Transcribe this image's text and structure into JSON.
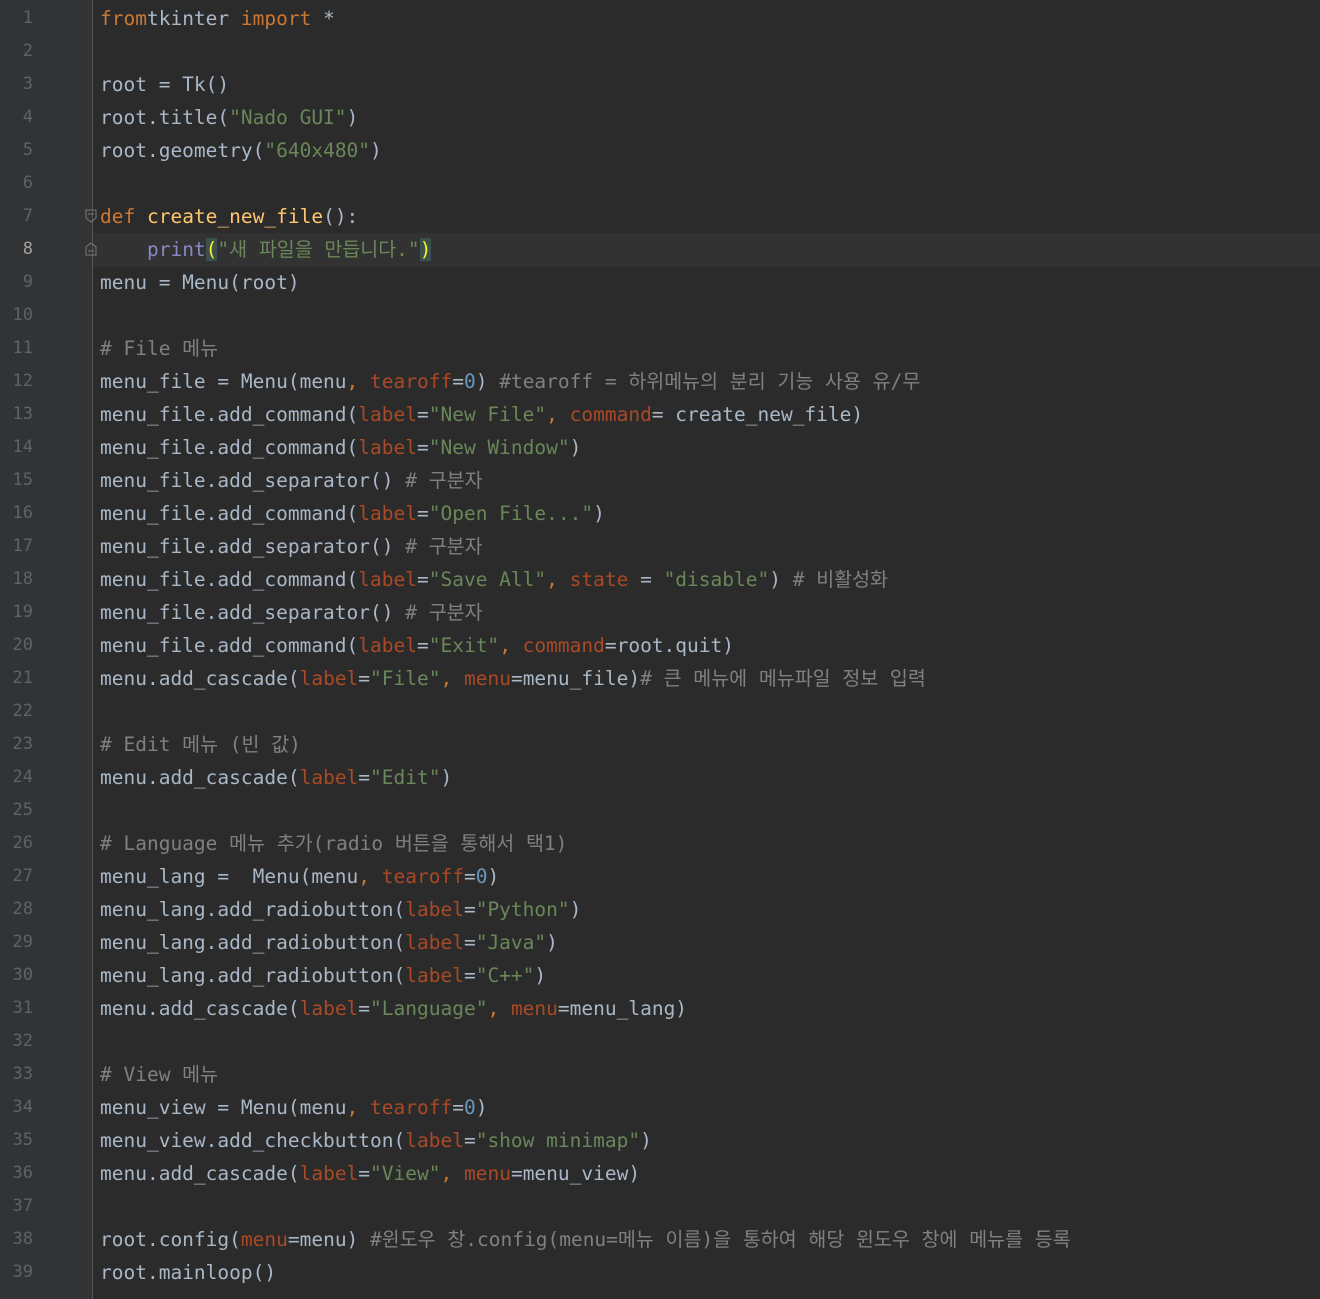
{
  "editor": {
    "current_line": 8,
    "lines": [
      {
        "n": "1",
        "tokens": [
          [
            "k",
            "from"
          ],
          [
            "",
            "tkinter "
          ],
          [
            "k",
            "import"
          ],
          [
            "",
            " *"
          ]
        ]
      },
      {
        "n": "2",
        "tokens": []
      },
      {
        "n": "3",
        "tokens": [
          [
            "",
            "root = Tk()"
          ]
        ]
      },
      {
        "n": "4",
        "tokens": [
          [
            "",
            "root.title("
          ],
          [
            "s",
            "\"Nado GUI\""
          ],
          [
            "",
            ")"
          ]
        ]
      },
      {
        "n": "5",
        "tokens": [
          [
            "",
            "root.geometry("
          ],
          [
            "s",
            "\"640x480\""
          ],
          [
            "",
            ")"
          ]
        ]
      },
      {
        "n": "6",
        "tokens": []
      },
      {
        "n": "7",
        "tokens": [
          [
            "k",
            "def "
          ],
          [
            "f",
            "create_new_file"
          ],
          [
            "",
            "():"
          ]
        ]
      },
      {
        "n": "8",
        "tokens": [
          [
            "",
            "    "
          ],
          [
            "b",
            "print"
          ],
          [
            "brace",
            "("
          ],
          [
            "s",
            "\"새 파일을 만듭니다.\""
          ],
          [
            "brace",
            ")"
          ]
        ]
      },
      {
        "n": "9",
        "tokens": [
          [
            "",
            "menu = Menu(root)"
          ]
        ]
      },
      {
        "n": "10",
        "tokens": []
      },
      {
        "n": "11",
        "tokens": [
          [
            "c",
            "# File 메뉴"
          ]
        ]
      },
      {
        "n": "12",
        "tokens": [
          [
            "",
            "menu_file = Menu(menu"
          ],
          [
            "k",
            ", "
          ],
          [
            "p",
            "tearoff"
          ],
          [
            "",
            "="
          ],
          [
            "n",
            "0"
          ],
          [
            "",
            ")"
          ],
          [
            "c",
            " #tearoff = 하위메뉴의 분리 기능 사용 유/무"
          ]
        ]
      },
      {
        "n": "13",
        "tokens": [
          [
            "",
            "menu_file.add_command("
          ],
          [
            "p",
            "label"
          ],
          [
            "",
            "="
          ],
          [
            "s",
            "\"New File\""
          ],
          [
            "k",
            ", "
          ],
          [
            "p",
            "command"
          ],
          [
            "",
            "= create_new_file)"
          ]
        ]
      },
      {
        "n": "14",
        "tokens": [
          [
            "",
            "menu_file.add_command("
          ],
          [
            "p",
            "label"
          ],
          [
            "",
            "="
          ],
          [
            "s",
            "\"New Window\""
          ],
          [
            "",
            ")"
          ]
        ]
      },
      {
        "n": "15",
        "tokens": [
          [
            "",
            "menu_file.add_separator()"
          ],
          [
            "c",
            " # 구분자"
          ]
        ]
      },
      {
        "n": "16",
        "tokens": [
          [
            "",
            "menu_file.add_command("
          ],
          [
            "p",
            "label"
          ],
          [
            "",
            "="
          ],
          [
            "s",
            "\"Open File...\""
          ],
          [
            "",
            ")"
          ]
        ]
      },
      {
        "n": "17",
        "tokens": [
          [
            "",
            "menu_file.add_separator()"
          ],
          [
            "c",
            " # 구분자"
          ]
        ]
      },
      {
        "n": "18",
        "tokens": [
          [
            "",
            "menu_file.add_command("
          ],
          [
            "p",
            "label"
          ],
          [
            "",
            "="
          ],
          [
            "s",
            "\"Save All\""
          ],
          [
            "k",
            ", "
          ],
          [
            "p",
            "state"
          ],
          [
            "",
            " = "
          ],
          [
            "s",
            "\"disable\""
          ],
          [
            "",
            ")"
          ],
          [
            "c",
            " # 비활성화"
          ]
        ]
      },
      {
        "n": "19",
        "tokens": [
          [
            "",
            "menu_file.add_separator()"
          ],
          [
            "c",
            " # 구분자"
          ]
        ]
      },
      {
        "n": "20",
        "tokens": [
          [
            "",
            "menu_file.add_command("
          ],
          [
            "p",
            "label"
          ],
          [
            "",
            "="
          ],
          [
            "s",
            "\"Exit\""
          ],
          [
            "k",
            ", "
          ],
          [
            "p",
            "command"
          ],
          [
            "",
            "=root.quit)"
          ]
        ]
      },
      {
        "n": "21",
        "tokens": [
          [
            "",
            "menu.add_cascade("
          ],
          [
            "p",
            "label"
          ],
          [
            "",
            "="
          ],
          [
            "s",
            "\"File\""
          ],
          [
            "k",
            ", "
          ],
          [
            "p",
            "menu"
          ],
          [
            "",
            "=menu_file)"
          ],
          [
            "c",
            "# 큰 메뉴에 메뉴파일 정보 입력"
          ]
        ]
      },
      {
        "n": "22",
        "tokens": []
      },
      {
        "n": "23",
        "tokens": [
          [
            "c",
            "# Edit 메뉴 (빈 값)"
          ]
        ]
      },
      {
        "n": "24",
        "tokens": [
          [
            "",
            "menu.add_cascade("
          ],
          [
            "p",
            "label"
          ],
          [
            "",
            "="
          ],
          [
            "s",
            "\"Edit\""
          ],
          [
            "",
            ")"
          ]
        ]
      },
      {
        "n": "25",
        "tokens": []
      },
      {
        "n": "26",
        "tokens": [
          [
            "c",
            "# Language 메뉴 추가(radio 버튼을 통해서 택1)"
          ]
        ]
      },
      {
        "n": "27",
        "tokens": [
          [
            "",
            "menu_lang =  Menu(menu"
          ],
          [
            "k",
            ", "
          ],
          [
            "p",
            "tearoff"
          ],
          [
            "",
            "="
          ],
          [
            "n",
            "0"
          ],
          [
            "",
            ")"
          ]
        ]
      },
      {
        "n": "28",
        "tokens": [
          [
            "",
            "menu_lang.add_radiobutton("
          ],
          [
            "p",
            "label"
          ],
          [
            "",
            "="
          ],
          [
            "s",
            "\"Python\""
          ],
          [
            "",
            ")"
          ]
        ]
      },
      {
        "n": "29",
        "tokens": [
          [
            "",
            "menu_lang.add_radiobutton("
          ],
          [
            "p",
            "label"
          ],
          [
            "",
            "="
          ],
          [
            "s",
            "\"Java\""
          ],
          [
            "",
            ")"
          ]
        ]
      },
      {
        "n": "30",
        "tokens": [
          [
            "",
            "menu_lang.add_radiobutton("
          ],
          [
            "p",
            "label"
          ],
          [
            "",
            "="
          ],
          [
            "s",
            "\"C++\""
          ],
          [
            "",
            ")"
          ]
        ]
      },
      {
        "n": "31",
        "tokens": [
          [
            "",
            "menu.add_cascade("
          ],
          [
            "p",
            "label"
          ],
          [
            "",
            "="
          ],
          [
            "s",
            "\"Language\""
          ],
          [
            "k",
            ", "
          ],
          [
            "p",
            "menu"
          ],
          [
            "",
            "=menu_lang)"
          ]
        ]
      },
      {
        "n": "32",
        "tokens": []
      },
      {
        "n": "33",
        "tokens": [
          [
            "c",
            "# View 메뉴"
          ]
        ]
      },
      {
        "n": "34",
        "tokens": [
          [
            "",
            "menu_view = Menu(menu"
          ],
          [
            "k",
            ", "
          ],
          [
            "p",
            "tearoff"
          ],
          [
            "",
            "="
          ],
          [
            "n",
            "0"
          ],
          [
            "",
            ")"
          ]
        ]
      },
      {
        "n": "35",
        "tokens": [
          [
            "",
            "menu_view.add_checkbutton("
          ],
          [
            "p",
            "label"
          ],
          [
            "",
            "="
          ],
          [
            "s",
            "\"show minimap\""
          ],
          [
            "",
            ")"
          ]
        ]
      },
      {
        "n": "36",
        "tokens": [
          [
            "",
            "menu.add_cascade("
          ],
          [
            "p",
            "label"
          ],
          [
            "",
            "="
          ],
          [
            "s",
            "\"View\""
          ],
          [
            "k",
            ", "
          ],
          [
            "p",
            "menu"
          ],
          [
            "",
            "=menu_view)"
          ]
        ]
      },
      {
        "n": "37",
        "tokens": []
      },
      {
        "n": "38",
        "tokens": [
          [
            "",
            "root.config("
          ],
          [
            "p",
            "menu"
          ],
          [
            "",
            "=menu)"
          ],
          [
            "c",
            " #윈도우 창.config(menu=메뉴 이름)을 통하여 해당 윈도우 창에 메뉴를 등록"
          ]
        ]
      },
      {
        "n": "39",
        "tokens": [
          [
            "",
            "root.mainloop()"
          ]
        ]
      }
    ]
  },
  "colors": {
    "background": "#2b2b2b",
    "gutter": "#313335",
    "keyword": "#cc7832",
    "string": "#6a8759",
    "number": "#6897bb",
    "param": "#aa4926",
    "comment": "#808080",
    "builtin": "#8888c6",
    "function_def": "#ffc66d",
    "default_text": "#a9b7c6"
  },
  "icons": [
    "fold-start-icon",
    "fold-end-icon"
  ]
}
